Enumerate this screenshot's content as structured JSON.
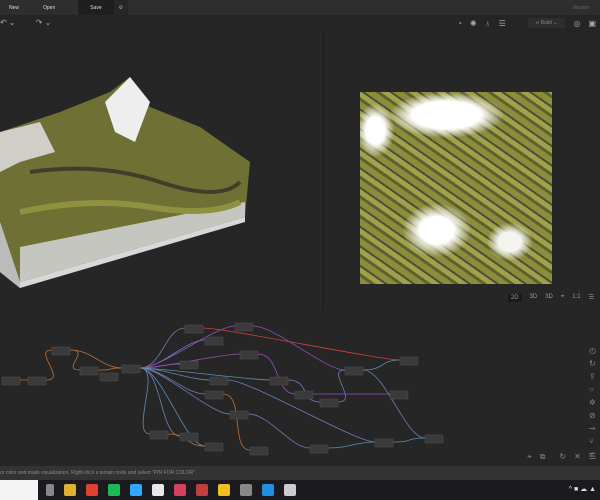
{
  "menu": {
    "items": [
      "New",
      "Open"
    ],
    "save": "Save",
    "version": "Version"
  },
  "toolbar": {
    "undo": "↶ ⌄",
    "redo": "↷ ⌄",
    "icons": [
      "compass-icon",
      "sun-icon",
      "water-drop-icon",
      "layers-icon"
    ],
    "build": "∞ Build ⌄"
  },
  "viewport2d": {
    "buttons": [
      "2D",
      "3D",
      "3D"
    ],
    "fit": "⌖",
    "ratio": "1:1"
  },
  "graph": {
    "edge_colors": [
      "#6f7fb0",
      "#c0723a",
      "#9a4fc0",
      "#5a8fb8",
      "#d04040"
    ]
  },
  "status": "or color and mask visualization. Right-click a terrain node and select \"PIN FOR COLOR\".",
  "taskbar": {
    "colors": [
      "#888",
      "#e0b030",
      "#e04030",
      "#1db954",
      "#31a8ff",
      "#e8e8e8",
      "#d84060",
      "#c04040",
      "#f0c020",
      "#888",
      "#2090e0",
      "#ccc"
    ],
    "tray": "^ ■ ☁ ▲"
  }
}
